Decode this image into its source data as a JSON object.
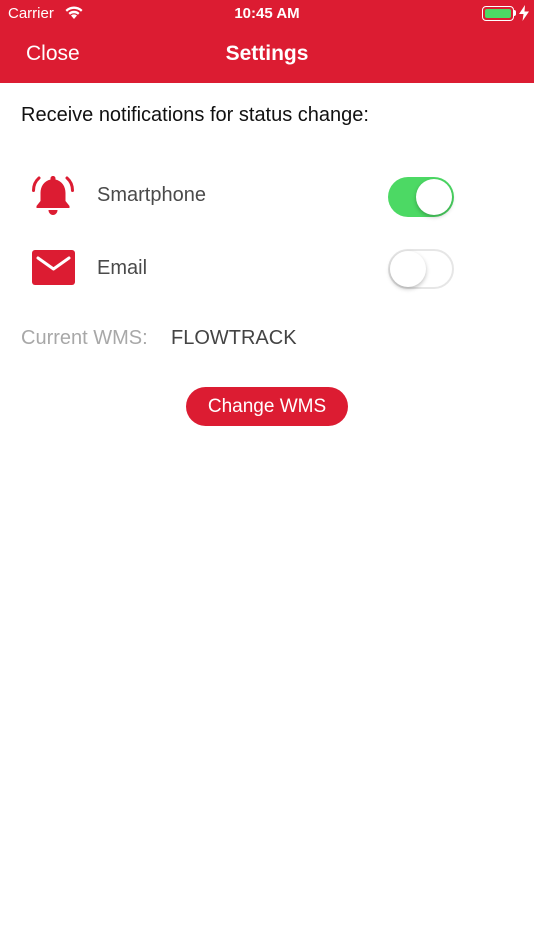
{
  "status_bar": {
    "carrier": "Carrier",
    "time": "10:45 AM",
    "wifi_icon": "wifi-icon",
    "battery_icon": "battery-icon",
    "charging_icon": "bolt-icon"
  },
  "nav": {
    "close_label": "Close",
    "title": "Settings"
  },
  "notifications": {
    "intro": "Receive notifications for status change:",
    "items": [
      {
        "label": "Smartphone",
        "icon": "bell-icon",
        "enabled": true
      },
      {
        "label": "Email",
        "icon": "envelope-icon",
        "enabled": false
      }
    ]
  },
  "wms": {
    "label": "Current WMS:",
    "value": "FLOWTRACK",
    "change_button": "Change WMS"
  },
  "colors": {
    "brand": "#dc1c32",
    "toggle_on": "#4cd964",
    "muted_text": "#a8a8a8"
  }
}
